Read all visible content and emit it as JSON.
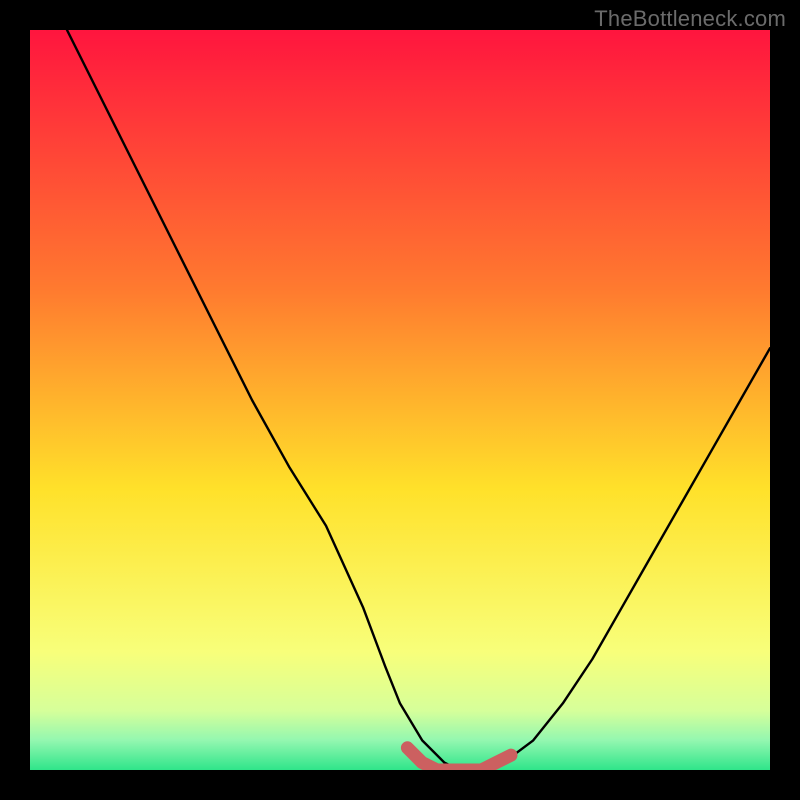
{
  "watermark": "TheBottleneck.com",
  "colors": {
    "bg_black": "#000000",
    "grad_top": "#ff153e",
    "grad_mid_upper": "#ff7a2f",
    "grad_mid": "#ffe12a",
    "grad_mid_lower": "#f8ff7a",
    "grad_band1": "#d6ff9a",
    "grad_band2": "#93f7b0",
    "grad_bottom": "#2fe58a",
    "curve_stroke": "#000000",
    "marker": "#cc6060"
  },
  "chart_data": {
    "type": "line",
    "title": "",
    "xlabel": "",
    "ylabel": "",
    "xlim": [
      0,
      100
    ],
    "ylim": [
      0,
      100
    ],
    "series": [
      {
        "name": "bottleneck-curve",
        "x": [
          5,
          10,
          15,
          20,
          25,
          30,
          35,
          40,
          45,
          48,
          50,
          53,
          56,
          58,
          61,
          64,
          68,
          72,
          76,
          80,
          84,
          88,
          92,
          96,
          100
        ],
        "y": [
          100,
          90,
          80,
          70,
          60,
          50,
          41,
          33,
          22,
          14,
          9,
          4,
          1,
          0,
          0,
          1,
          4,
          9,
          15,
          22,
          29,
          36,
          43,
          50,
          57
        ]
      },
      {
        "name": "optimal-zone-marker",
        "x": [
          51,
          53,
          55,
          57,
          59,
          61,
          63,
          65
        ],
        "y": [
          3,
          1,
          0,
          0,
          0,
          0,
          1,
          2
        ]
      }
    ],
    "annotations": []
  }
}
